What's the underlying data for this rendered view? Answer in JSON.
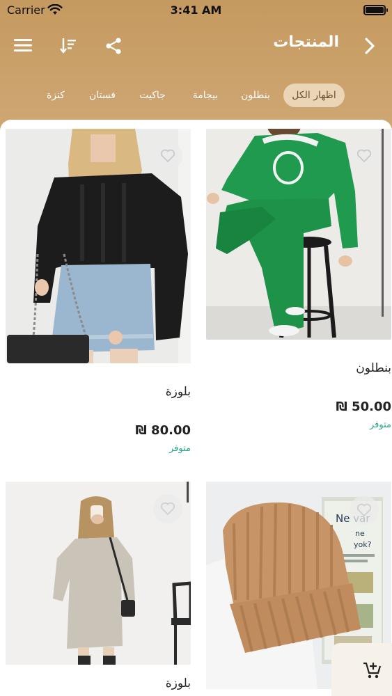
{
  "status_bar": {
    "carrier": "Carrier",
    "time": "3:41 AM"
  },
  "nav": {
    "title": "المنتجات"
  },
  "categories": [
    {
      "label": "اظهار الكل",
      "active": true
    },
    {
      "label": "بنطلون",
      "active": false
    },
    {
      "label": "بيجامة",
      "active": false
    },
    {
      "label": "جاكيت",
      "active": false
    },
    {
      "label": "فستان",
      "active": false
    },
    {
      "label": "كنزة",
      "active": false
    }
  ],
  "products": [
    {
      "name": "بنطلون",
      "price": "₪ 50.00",
      "stock": "متوفر"
    },
    {
      "name": "بلوزة",
      "price": "₪ 80.00",
      "stock": "متوفر"
    },
    {
      "name": "",
      "price": "",
      "stock": ""
    },
    {
      "name": "بلوزة",
      "price": "",
      "stock": ""
    }
  ],
  "colors": {
    "header": "#c9a16a",
    "chip_active_bg": "#ead6b6",
    "in_stock": "#2aa58a",
    "sweater_green": "#1f9a4f",
    "beanie_tan": "#c18f62"
  },
  "icons": [
    "menu-icon",
    "sort-icon",
    "share-icon",
    "chevron-right-icon",
    "heart-icon",
    "add-to-cart-icon",
    "wifi-icon",
    "battery-icon"
  ]
}
